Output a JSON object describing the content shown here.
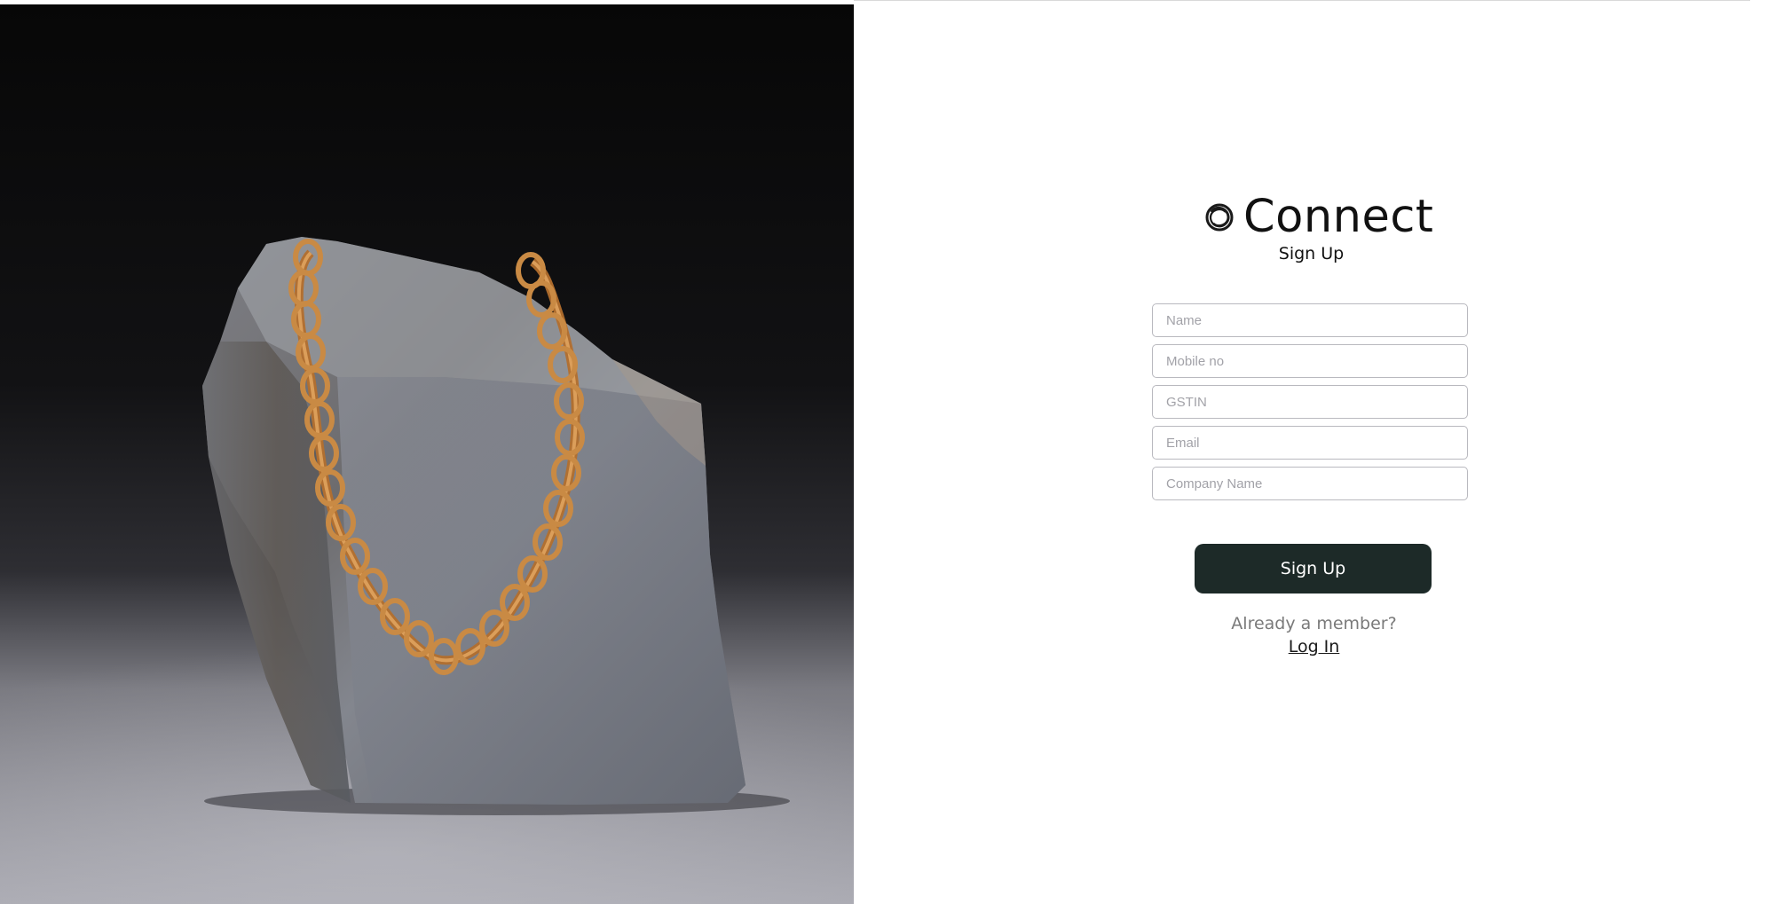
{
  "brand": {
    "name": "Connect",
    "subtitle": "Sign Up",
    "icon": "ring-logo-icon"
  },
  "form": {
    "fields": [
      {
        "name": "name-field",
        "placeholder": "Name",
        "value": ""
      },
      {
        "name": "mobile-field",
        "placeholder": "Mobile no",
        "value": ""
      },
      {
        "name": "gstin-field",
        "placeholder": "GSTIN",
        "value": ""
      },
      {
        "name": "email-field",
        "placeholder": "Email",
        "value": ""
      },
      {
        "name": "company-name-field",
        "placeholder": "Company Name",
        "value": ""
      }
    ],
    "submit_label": "Sign Up"
  },
  "footer": {
    "member_text": "Already a member?",
    "login_label": "Log In"
  },
  "colors": {
    "button_bg": "#1d2a28",
    "button_text": "#ffffff",
    "muted_text": "#7a7a7a"
  }
}
